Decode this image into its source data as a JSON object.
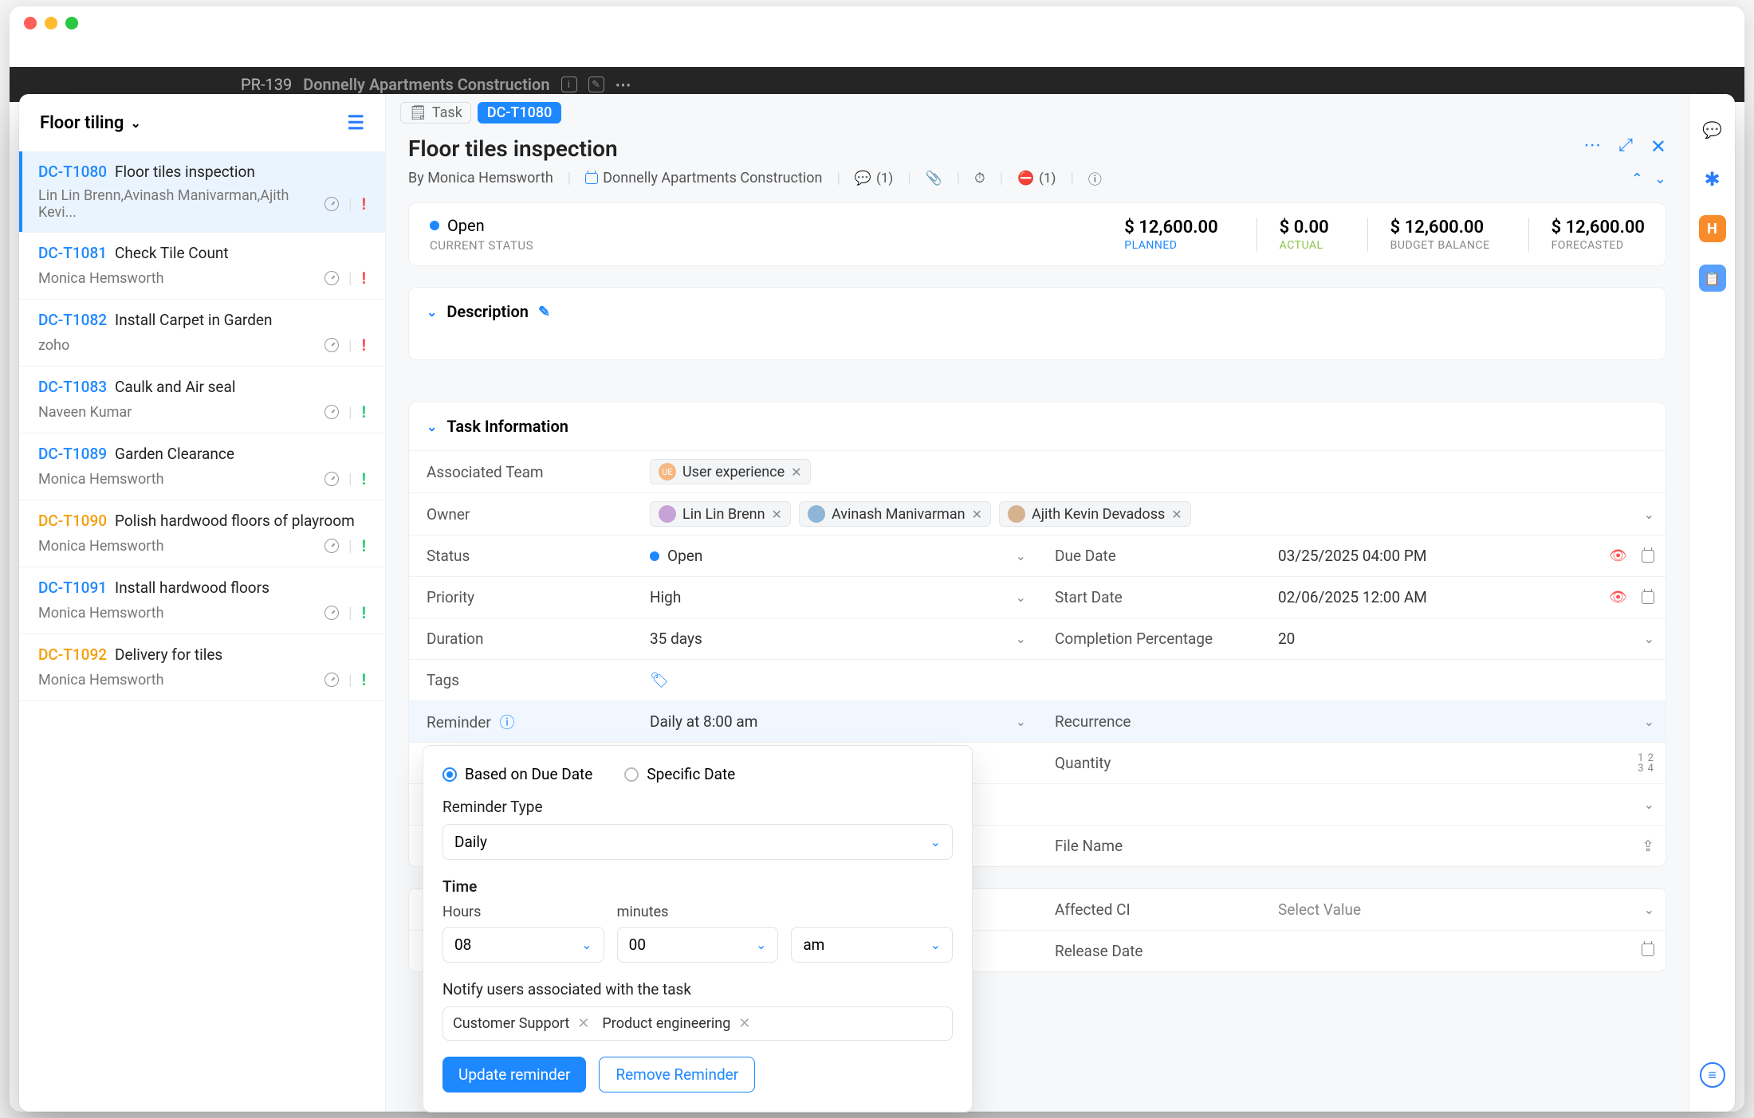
{
  "window": {
    "project_id": "PR-139",
    "project_name": "Donnelly Apartments Construction"
  },
  "sidebar": {
    "title": "Floor tiling",
    "items": [
      {
        "id": "DC-T1080",
        "idcolor": "blue",
        "name": "Floor tiles inspection",
        "owner": "Lin Lin Brenn,Avinash Manivarman,Ajith Kevi...",
        "priority": "red",
        "active": true
      },
      {
        "id": "DC-T1081",
        "idcolor": "blue",
        "name": "Check Tile Count",
        "owner": "Monica Hemsworth",
        "priority": "red"
      },
      {
        "id": "DC-T1082",
        "idcolor": "blue",
        "name": "Install Carpet in Garden",
        "owner": "zoho",
        "priority": "red"
      },
      {
        "id": "DC-T1083",
        "idcolor": "blue",
        "name": "Caulk and Air seal",
        "owner": "Naveen Kumar",
        "priority": "green"
      },
      {
        "id": "DC-T1089",
        "idcolor": "blue",
        "name": "Garden Clearance",
        "owner": "Monica Hemsworth",
        "priority": "green"
      },
      {
        "id": "DC-T1090",
        "idcolor": "orange",
        "name": "Polish hardwood floors of playroom",
        "owner": "Monica Hemsworth",
        "priority": "green"
      },
      {
        "id": "DC-T1091",
        "idcolor": "blue",
        "name": "Install hardwood floors",
        "owner": "Monica Hemsworth",
        "priority": "green"
      },
      {
        "id": "DC-T1092",
        "idcolor": "orange",
        "name": "Delivery for tiles",
        "owner": "Monica Hemsworth",
        "priority": "green"
      }
    ]
  },
  "crumb": {
    "task_label": "Task",
    "task_id": "DC-T1080"
  },
  "header": {
    "title": "Floor tiles inspection",
    "by_label": "By",
    "author": "Monica Hemsworth",
    "project": "Donnelly Apartments Construction",
    "comments": "(1)",
    "blockers": "(1)"
  },
  "status": {
    "open": "Open",
    "current_status": "CURRENT STATUS",
    "planned": {
      "amount": "$ 12,600.00",
      "label": "PLANNED"
    },
    "actual": {
      "amount": "$ 0.00",
      "label": "ACTUAL"
    },
    "budget": {
      "amount": "$ 12,600.00",
      "label": "BUDGET BALANCE"
    },
    "forecast": {
      "amount": "$ 12,600.00",
      "label": "FORECASTED"
    }
  },
  "sections": {
    "description": "Description",
    "task_info": "Task Information"
  },
  "fields": {
    "assoc_team": {
      "label": "Associated Team",
      "value": "User experience"
    },
    "owner": {
      "label": "Owner",
      "values": [
        "Lin Lin Brenn",
        "Avinash Manivarman",
        "Ajith Kevin Devadoss"
      ]
    },
    "status": {
      "label": "Status",
      "value": "Open"
    },
    "due_date": {
      "label": "Due Date",
      "value": "03/25/2025 04:00 PM"
    },
    "priority": {
      "label": "Priority",
      "value": "High"
    },
    "start_date": {
      "label": "Start Date",
      "value": "02/06/2025 12:00 AM"
    },
    "duration": {
      "label": "Duration",
      "value": "35  days"
    },
    "completion": {
      "label": "Completion Percentage",
      "value": "20"
    },
    "tags": {
      "label": "Tags"
    },
    "reminder": {
      "label": "Reminder",
      "value": "Daily at 8:00 am"
    },
    "recurrence": {
      "label": "Recurrence"
    },
    "quantity": {
      "label": "Quantity"
    },
    "filename": {
      "label": "File Name"
    },
    "affected_ci": {
      "label": "Affected CI",
      "value": "Select Value"
    },
    "release_date": {
      "label": "Release Date"
    }
  },
  "reminder_popup": {
    "opt_due": "Based on Due Date",
    "opt_spec": "Specific Date",
    "type_label": "Reminder Type",
    "type_value": "Daily",
    "time_label": "Time",
    "hours_label": "Hours",
    "hours_value": "08",
    "minutes_label": "minutes",
    "minutes_value": "00",
    "ampm_value": "am",
    "notify_label": "Notify users associated with the task",
    "notify_tags": [
      "Customer Support",
      "Product engineering"
    ],
    "btn_update": "Update reminder",
    "btn_remove": "Remove Reminder"
  }
}
